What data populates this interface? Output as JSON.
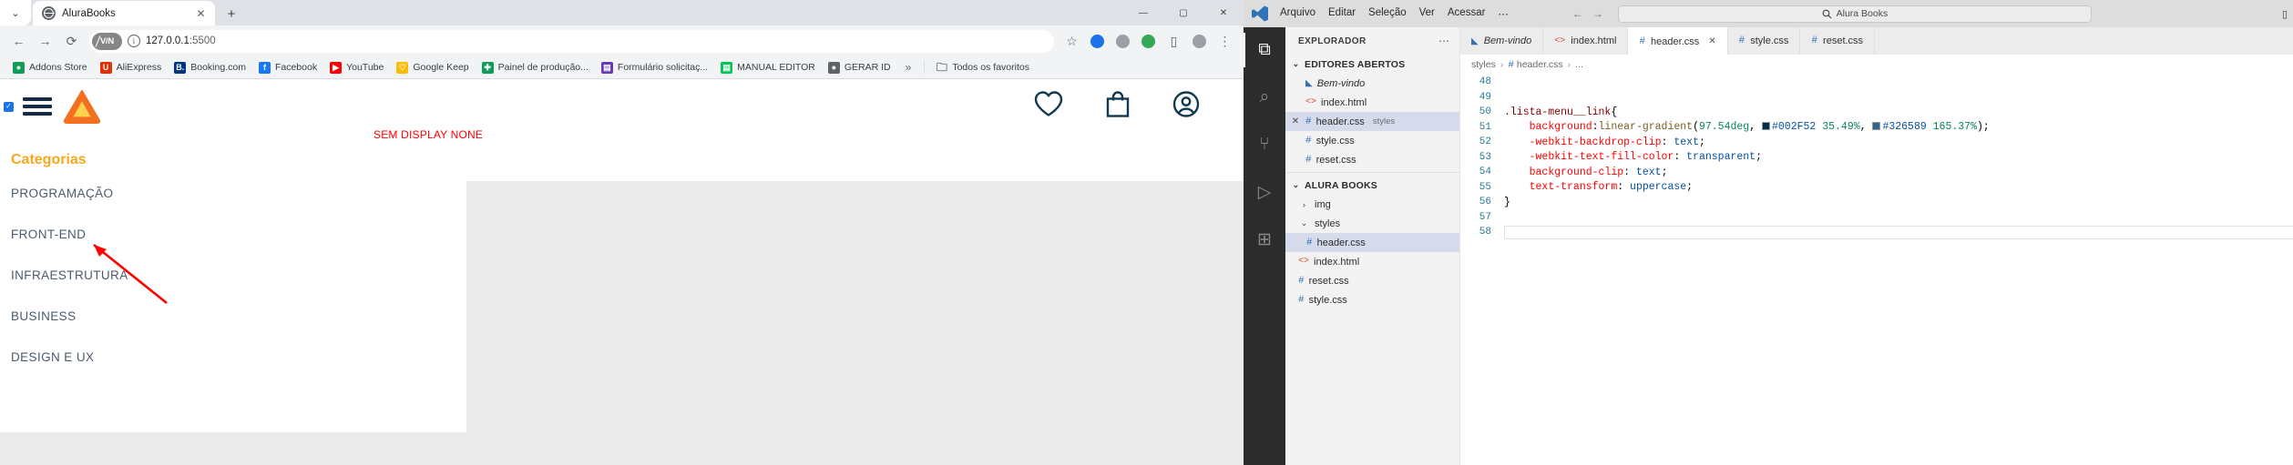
{
  "browser": {
    "tab": {
      "title": "AluraBooks",
      "favicon": "globe-icon",
      "close": "✕",
      "newtab": "+"
    },
    "tabstrip_menu": "⌄",
    "window_controls": {
      "minimize": "—",
      "maximize": "▢",
      "close": "✕"
    },
    "toolbar": {
      "back": "←",
      "forward": "→",
      "reload": "⟳",
      "vpn_label": "V/N",
      "info": "i",
      "url_host": "127.0.0.1",
      "url_port": ":5500",
      "star": "☆",
      "ext_blue": "◉",
      "ext_grey": "⚙",
      "ext_chrome": "◍",
      "split": "▯",
      "profile": "◕",
      "menu": "⋮"
    },
    "bookmarks": [
      {
        "label": "Addons Store",
        "color": "#0f9d58",
        "glyph": "●"
      },
      {
        "label": "AliExpress",
        "color": "#e62e04",
        "glyph": "U"
      },
      {
        "label": "Booking.com",
        "color": "#003580",
        "glyph": "B."
      },
      {
        "label": "Facebook",
        "color": "#1877f2",
        "glyph": "f"
      },
      {
        "label": "YouTube",
        "color": "#ff0000",
        "glyph": "▶"
      },
      {
        "label": "Google Keep",
        "color": "#fbbc04",
        "glyph": "♡"
      },
      {
        "label": "Painel de produção...",
        "color": "#0f9d58",
        "glyph": "✚"
      },
      {
        "label": "Formulário solicitaç...",
        "color": "#673ab7",
        "glyph": "▤"
      },
      {
        "label": "MANUAL EDITOR",
        "color": "#00c853",
        "glyph": "▤"
      },
      {
        "label": "GERAR ID",
        "color": "#5f6368",
        "glyph": "●"
      }
    ],
    "bookmarks_overflow": "»",
    "bookmarks_all": {
      "label": "Todos os favoritos",
      "icon": "folder-icon"
    },
    "page": {
      "checkbox_checked": "✓",
      "menu_icon": "hamburger-icon",
      "logo": "alura-triangle-logo",
      "categorias_title": "Categorias",
      "categories": [
        "PROGRAMAÇÃO",
        "FRONT-END",
        "INFRAESTRUTURA",
        "BUSINESS",
        "DESIGN E UX"
      ],
      "annotation": "SEM DISPLAY NONE",
      "annotation_color": "#ff0000",
      "header_icons": [
        "heart-icon",
        "bag-icon",
        "account-icon"
      ],
      "accent_orange": "#f7a81b",
      "text_navy": "#152c44"
    }
  },
  "vscode": {
    "titlebar": {
      "logo": "vscode-logo",
      "menu": [
        "Arquivo",
        "Editar",
        "Seleção",
        "Ver",
        "Acessar",
        "⋯"
      ],
      "nav_back": "←",
      "nav_forward": "→",
      "search_icon": "search-icon",
      "search_text": "Alura Books",
      "layout_icon": "layout-icon"
    },
    "activitybar": [
      {
        "name": "explorer-icon",
        "glyph": "⧉",
        "active": true
      },
      {
        "name": "search-icon",
        "glyph": "⌕",
        "active": false
      },
      {
        "name": "source-control-icon",
        "glyph": "⑂",
        "active": false
      },
      {
        "name": "run-debug-icon",
        "glyph": "▷",
        "active": false
      },
      {
        "name": "extensions-icon",
        "glyph": "⊞",
        "active": false
      }
    ],
    "sidebar": {
      "title": "EXPLORADOR",
      "more": "⋯",
      "open_editors": {
        "label": "EDITORES ABERTOS",
        "chevron": "⌄",
        "items": [
          {
            "name": "Bem-vindo",
            "icon": "vscode-icon",
            "italic": true,
            "sub": "",
            "selected": false,
            "close": ""
          },
          {
            "name": "index.html",
            "icon": "html-icon",
            "italic": false,
            "sub": "",
            "selected": false,
            "close": ""
          },
          {
            "name": "header.css",
            "icon": "css-icon",
            "italic": false,
            "sub": "styles",
            "selected": true,
            "close": "✕"
          },
          {
            "name": "style.css",
            "icon": "css-icon",
            "italic": false,
            "sub": "",
            "selected": false,
            "close": ""
          },
          {
            "name": "reset.css",
            "icon": "css-icon",
            "italic": false,
            "sub": "",
            "selected": false,
            "close": ""
          }
        ]
      },
      "project": {
        "label": "ALURA BOOKS",
        "chevron": "⌄",
        "items": [
          {
            "name": "img",
            "icon": "folder-icon",
            "chevron": "›",
            "indent": 1,
            "selected": false
          },
          {
            "name": "styles",
            "icon": "folder-icon",
            "chevron": "⌄",
            "indent": 1,
            "selected": false
          },
          {
            "name": "header.css",
            "icon": "css-icon",
            "chevron": "",
            "indent": 2,
            "selected": true
          },
          {
            "name": "index.html",
            "icon": "html-icon",
            "chevron": "",
            "indent": 1,
            "selected": false
          },
          {
            "name": "reset.css",
            "icon": "css-icon",
            "chevron": "",
            "indent": 1,
            "selected": false
          },
          {
            "name": "style.css",
            "icon": "css-icon",
            "chevron": "",
            "indent": 1,
            "selected": false
          }
        ]
      }
    },
    "editor_tabs": [
      {
        "label": "Bem-vindo",
        "icon": "vscode-icon",
        "active": false,
        "italic": true,
        "close": ""
      },
      {
        "label": "index.html",
        "icon": "html-icon",
        "active": false,
        "italic": false,
        "close": ""
      },
      {
        "label": "header.css",
        "icon": "css-icon",
        "active": true,
        "italic": false,
        "close": "✕"
      },
      {
        "label": "style.css",
        "icon": "css-icon",
        "active": false,
        "italic": false,
        "close": ""
      },
      {
        "label": "reset.css",
        "icon": "css-icon",
        "active": false,
        "italic": false,
        "close": ""
      }
    ],
    "breadcrumb": [
      "styles",
      "header.css",
      "..."
    ],
    "code": {
      "first_line_number": 48,
      "lines": [
        {
          "n": 48,
          "html": ""
        },
        {
          "n": 49,
          "html": ""
        },
        {
          "n": 50,
          "html": "<span class='k-sel'>.lista-menu__link</span><span class='k-punct'>{</span>"
        },
        {
          "n": 51,
          "html": "    <span class='k-prop'>background</span><span class='k-punct'>:</span><span class='k-fn'>linear-gradient</span><span class='k-punct'>(</span><span class='k-num'>97.54deg</span><span class='k-punct'>, </span><span class='swatch' style='background:#002F52'></span><span class='k-val'>#002F52</span> <span class='k-num'>35.49%</span><span class='k-punct'>, </span><span class='swatch' style='background:#326589'></span><span class='k-val'>#326589</span> <span class='k-num'>165.37%</span><span class='k-punct'>);</span>"
        },
        {
          "n": 52,
          "html": "    <span class='k-prop'>-webkit-backdrop-clip</span><span class='k-punct'>: </span><span class='k-val'>text</span><span class='k-punct'>;</span>"
        },
        {
          "n": 53,
          "html": "    <span class='k-prop'>-webkit-text-fill-color</span><span class='k-punct'>: </span><span class='k-val'>transparent</span><span class='k-punct'>;</span>"
        },
        {
          "n": 54,
          "html": "    <span class='k-prop'>background-clip</span><span class='k-punct'>: </span><span class='k-val'>text</span><span class='k-punct'>;</span>"
        },
        {
          "n": 55,
          "html": "    <span class='k-prop'>text-transform</span><span class='k-punct'>: </span><span class='k-val'>uppercase</span><span class='k-punct'>;</span>"
        },
        {
          "n": 56,
          "html": "<span class='k-punct'>}</span>"
        },
        {
          "n": 57,
          "html": ""
        },
        {
          "n": 58,
          "html": "",
          "cursor": true
        }
      ],
      "raw_text": ".lista-menu__link{\n    background:linear-gradient(97.54deg, #002F52 35.49%, #326589 165.37%);\n    -webkit-backdrop-clip: text;\n    -webkit-text-fill-color: transparent;\n    background-clip: text;\n    text-transform: uppercase;\n}"
    }
  }
}
